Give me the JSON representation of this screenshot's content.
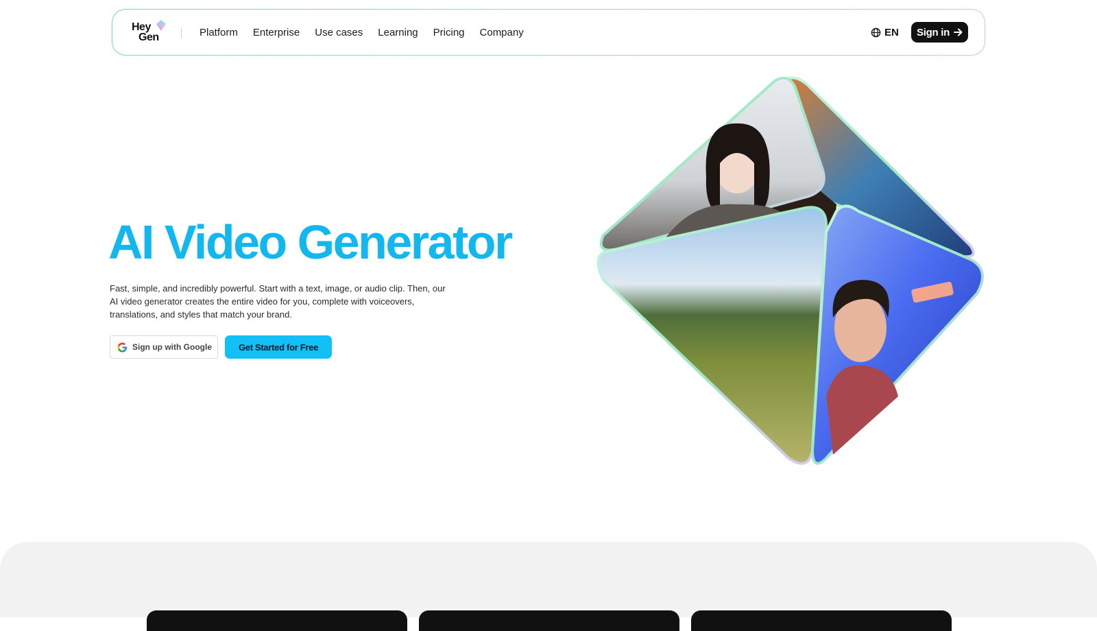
{
  "nav": {
    "logo": {
      "line1": "Hey",
      "line2": "Gen"
    },
    "items": [
      {
        "label": "Platform"
      },
      {
        "label": "Enterprise"
      },
      {
        "label": "Use cases"
      },
      {
        "label": "Learning"
      },
      {
        "label": "Pricing"
      },
      {
        "label": "Company"
      }
    ],
    "language": "EN",
    "signin_label": "Sign in"
  },
  "hero": {
    "title": "AI Video Generator",
    "description": "Fast, simple, and incredibly powerful. Start with a text, image, or audio clip. Then, our AI video generator creates the entire video for you, complete with voiceovers, translations, and styles that match your brand.",
    "google_button": "Sign up with Google",
    "start_button": "Get Started for Free"
  },
  "colors": {
    "accent": "#11b8f0",
    "button_primary": "#12c0f5",
    "dark": "#111111"
  }
}
